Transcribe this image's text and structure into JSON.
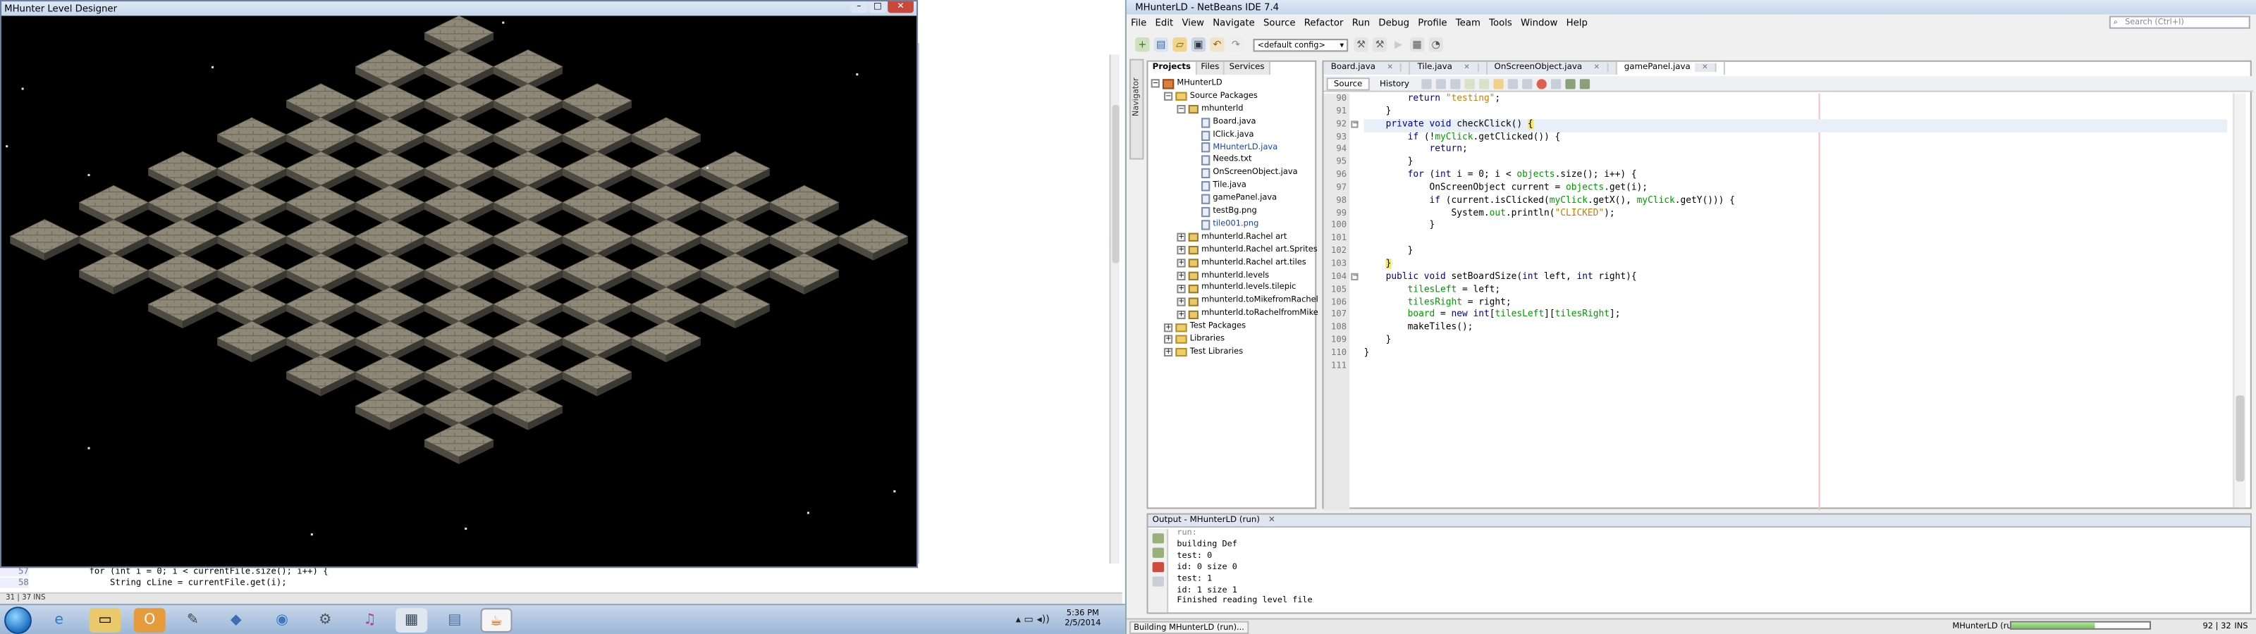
{
  "game_window": {
    "title": "MHunter Level Designer",
    "controls": [
      "–",
      "□",
      "✕"
    ]
  },
  "background_ide": {
    "code_lines": [
      {
        "num": "57",
        "text": "for (int i = 0; i < currentFile.size(); i++) {"
      },
      {
        "num": "58",
        "text": "    String cLine = currentFile.get(i);"
      }
    ],
    "status": "31 | 37  INS"
  },
  "netbeans": {
    "title": "MHunterLD - NetBeans IDE 7.4",
    "menu": [
      "File",
      "Edit",
      "View",
      "Navigate",
      "Source",
      "Refactor",
      "Run",
      "Debug",
      "Profile",
      "Team",
      "Tools",
      "Window",
      "Help"
    ],
    "search_placeholder": "Search (Ctrl+I)",
    "config": "<default config>",
    "navigator_label": "Navigator",
    "project_tabs": [
      "Projects",
      "Files",
      "Services"
    ],
    "tree": [
      {
        "label": "MHunterLD",
        "depth": 0,
        "kind": "project",
        "exp": "−"
      },
      {
        "label": "Source Packages",
        "depth": 1,
        "kind": "folder",
        "exp": "−"
      },
      {
        "label": "mhunterld",
        "depth": 2,
        "kind": "package",
        "exp": "−"
      },
      {
        "label": "Board.java",
        "depth": 3,
        "kind": "java"
      },
      {
        "label": "IClick.java",
        "depth": 3,
        "kind": "java"
      },
      {
        "label": "MHunterLD.java",
        "depth": 3,
        "kind": "java",
        "selected": true
      },
      {
        "label": "Needs.txt",
        "depth": 3,
        "kind": "java"
      },
      {
        "label": "OnScreenObject.java",
        "depth": 3,
        "kind": "java"
      },
      {
        "label": "Tile.java",
        "depth": 3,
        "kind": "java"
      },
      {
        "label": "gamePanel.java",
        "depth": 3,
        "kind": "java"
      },
      {
        "label": "testBg.png",
        "depth": 3,
        "kind": "java"
      },
      {
        "label": "tile001.png",
        "depth": 3,
        "kind": "java",
        "selected": true
      },
      {
        "label": "mhunterld.Rachel art",
        "depth": 2,
        "kind": "package",
        "exp": "+"
      },
      {
        "label": "mhunterld.Rachel art.Sprites",
        "depth": 2,
        "kind": "package",
        "exp": "+"
      },
      {
        "label": "mhunterld.Rachel art.tiles",
        "depth": 2,
        "kind": "package",
        "exp": "+"
      },
      {
        "label": "mhunterld.levels",
        "depth": 2,
        "kind": "package",
        "exp": "+"
      },
      {
        "label": "mhunterld.levels.tilepic",
        "depth": 2,
        "kind": "package",
        "exp": "+"
      },
      {
        "label": "mhunterld.toMikefromRachel",
        "depth": 2,
        "kind": "package",
        "exp": "+"
      },
      {
        "label": "mhunterld.toRachelfromMike",
        "depth": 2,
        "kind": "package",
        "exp": "+"
      },
      {
        "label": "Test Packages",
        "depth": 1,
        "kind": "folder",
        "exp": "+"
      },
      {
        "label": "Libraries",
        "depth": 1,
        "kind": "folder",
        "exp": "+"
      },
      {
        "label": "Test Libraries",
        "depth": 1,
        "kind": "folder",
        "exp": "+"
      }
    ],
    "editor_tabs": [
      "Board.java",
      "Tile.java",
      "OnScreenObject.java",
      "gamePanel.java"
    ],
    "source_tabs": [
      "Source",
      "History"
    ],
    "line_numbers": [
      "90",
      "91",
      "92",
      "93",
      "94",
      "95",
      "96",
      "97",
      "98",
      "99",
      "100",
      "101",
      "102",
      "103",
      "104",
      "105",
      "106",
      "107",
      "108",
      "109",
      "110",
      "111"
    ],
    "output_title": "Output - MHunterLD (run)",
    "output_lines": [
      "run:",
      "building Def",
      "test: 0",
      "id: 0 size 0",
      "test: 1",
      "id: 1 size 1",
      "Finished reading  level file"
    ],
    "status_left": "Building MHunterLD (run)...",
    "status_right_project": "MHunterLD (run)",
    "status_pos": "92 | 32",
    "status_mode": "INS"
  },
  "taskbar": {
    "time": "5:36 PM",
    "date": "2/5/2014",
    "icons": [
      "ie-icon",
      "explorer-icon",
      "outlook-icon",
      "paint-icon",
      "box-icon",
      "chrome-icon",
      "tool-icon",
      "itunes-icon",
      "app-icon",
      "notes-icon",
      "java-icon"
    ]
  },
  "colors": {
    "keyword": "#00008b",
    "string": "#ce7b00",
    "field": "#009900",
    "tile_top": "#8e8878"
  }
}
